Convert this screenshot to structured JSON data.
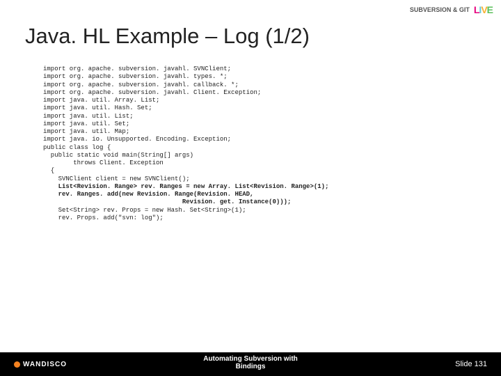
{
  "header": {
    "logo_text": "SUBVERSION & GIT",
    "live": [
      "L",
      "I",
      "V",
      "E"
    ]
  },
  "title": "Java. HL Example – Log (1/2)",
  "code": {
    "lines": [
      {
        "t": "import org. apache. subversion. javahl. SVNClient;"
      },
      {
        "t": "import org. apache. subversion. javahl. types. *;"
      },
      {
        "t": "import org. apache. subversion. javahl. callback. *;"
      },
      {
        "t": "import org. apache. subversion. javahl. Client. Exception;"
      },
      {
        "t": ""
      },
      {
        "t": "import java. util. Array. List;"
      },
      {
        "t": "import java. util. Hash. Set;"
      },
      {
        "t": "import java. util. List;"
      },
      {
        "t": "import java. util. Set;"
      },
      {
        "t": "import java. util. Map;"
      },
      {
        "t": "import java. io. Unsupported. Encoding. Exception;"
      },
      {
        "t": ""
      },
      {
        "t": "public class log {"
      },
      {
        "t": ""
      },
      {
        "t": "  public static void main(String[] args)"
      },
      {
        "t": "        throws Client. Exception"
      },
      {
        "t": "  {"
      },
      {
        "t": "    SVNClient client = new SVNClient();"
      },
      {
        "t": "    List<Revision. Range> rev. Ranges = new Array. List<Revision. Range>(1);",
        "b": true
      },
      {
        "t": "    rev. Ranges. add(new Revision. Range(Revision. HEAD,",
        "b": true
      },
      {
        "t": "                                     Revision. get. Instance(0)));",
        "b": true
      },
      {
        "t": "    Set<String> rev. Props = new Hash. Set<String>(1);"
      },
      {
        "t": "    rev. Props. add(\"svn: log\");"
      }
    ]
  },
  "footer": {
    "brand": "WANDISCO",
    "center_line1": "Automating Subversion with",
    "center_line2": "Bindings",
    "slide": "Slide 131"
  }
}
